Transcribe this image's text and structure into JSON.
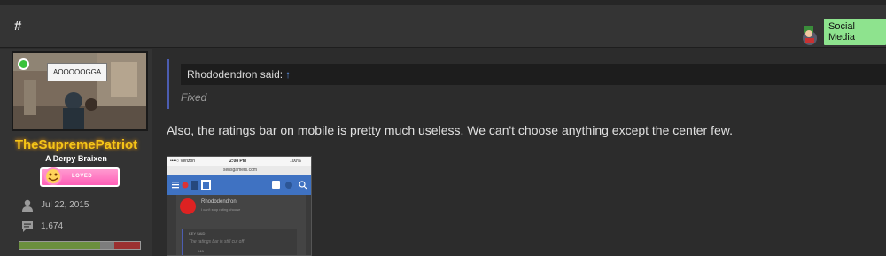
{
  "header": {
    "hash": "#",
    "social_label": "Social Media",
    "colors": {
      "social_bg": "#8ee38e"
    }
  },
  "sidebar": {
    "avatar_speech": "AOOOOOGGA",
    "username": "TheSupremePatriot",
    "user_title": "A Derpy Braixen",
    "badge_label": "LOVED",
    "join_date": "Jul 22, 2015",
    "message_count": "1,674",
    "icons": [
      "user-icon",
      "chat-icon"
    ],
    "rating_bar": {
      "positive": 0.67,
      "neutral": 0.12,
      "negative": 0.21
    }
  },
  "post": {
    "quote_author": "Rhododendron said:",
    "quote_arrow": "↑",
    "quote_text": "Fixed",
    "message": "Also, the ratings bar on mobile is pretty much useless. We can't choose anything except the center few."
  },
  "screenshot": {
    "carrier": "••••○ Verizon",
    "time": "2:08 PM",
    "battery": "100%",
    "url": "sensgamers.com",
    "name": "Rhododendron",
    "subtitle": "I can't stop rating choose",
    "quote_header": "KEY SAID",
    "quote_text": "The ratings bar is still cut off",
    "count": "149"
  }
}
